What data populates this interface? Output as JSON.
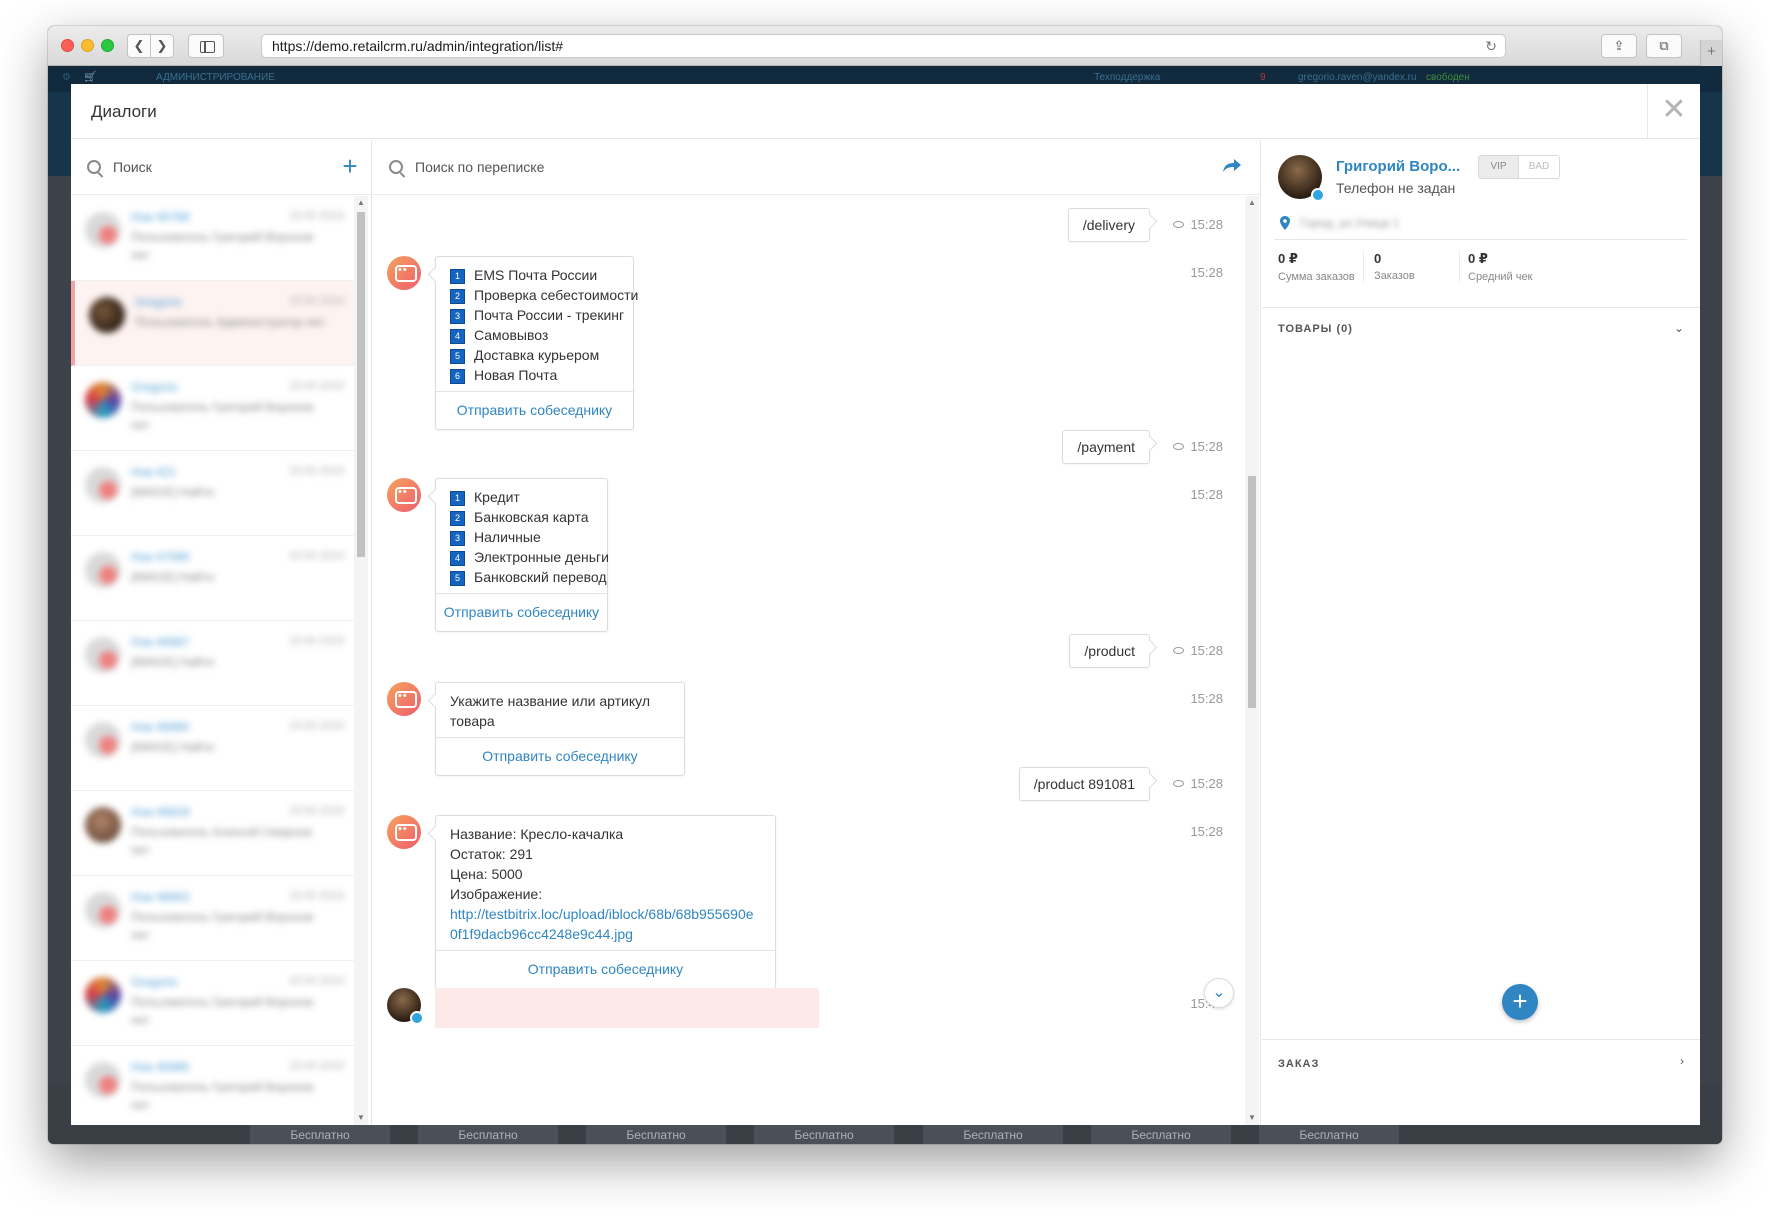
{
  "browser": {
    "url": "https://demo.retailcrm.ru/admin/integration/list#"
  },
  "crm_background": {
    "top_left_label": "АДМИНИСТРИРОВАНИЕ",
    "support": "Техподдержка",
    "notif_count": "9",
    "user_email": "gregorio.raven@yandex.ru",
    "user_status": "свободен",
    "free_label": "Бесплатно"
  },
  "modal": {
    "title": "Диалоги",
    "close_glyph": "✕"
  },
  "left_panel": {
    "search_placeholder": "Поиск",
    "add_glyph": "+",
    "dialogs": [
      {
        "name": "Нов 45789",
        "time": "15:00 2019",
        "preview": "Пользователь Григорий Воронов пит",
        "avatar": "red",
        "active": false
      },
      {
        "name": "Gregorio",
        "time": "15:00 2019",
        "preview": "Пользователь Администратор пит",
        "avatar": "photo",
        "active": true
      },
      {
        "name": "Gregorio",
        "time": "15:00 2019",
        "preview": "Пользователь Григорий Воронов пит",
        "avatar": "colorful",
        "active": false
      },
      {
        "name": "Нов 421",
        "time": "15:00 2019",
        "preview": "[IMAGE] Найти",
        "avatar": "red",
        "active": false
      },
      {
        "name": "Нов 47090",
        "time": "15:00 2019",
        "preview": "[IMAGE] Найти",
        "avatar": "red",
        "active": false
      },
      {
        "name": "Нов 46987",
        "time": "15:00 2019",
        "preview": "[IMAGE] Найти",
        "avatar": "red",
        "active": false
      },
      {
        "name": "Нов 46980",
        "time": "15:00 2019",
        "preview": "[IMAGE] Найти",
        "avatar": "red",
        "active": false
      },
      {
        "name": "Нов 46829",
        "time": "15:00 2019",
        "preview": "Пользователь Алексей Смирнов пит",
        "avatar": "bro",
        "active": false
      },
      {
        "name": "Нов 46663",
        "time": "15:00 2019",
        "preview": "Пользователь Григорий Воронов пит",
        "avatar": "red",
        "active": false
      },
      {
        "name": "Gregorio",
        "time": "15:00 2019",
        "preview": "Пользователь Григорий Воронов пит",
        "avatar": "colorful",
        "active": false
      },
      {
        "name": "Нов 45985",
        "time": "15:00 2019",
        "preview": "Пользователь Григорий Воронов пит",
        "avatar": "red",
        "active": false
      }
    ]
  },
  "chat": {
    "search_placeholder": "Поиск по переписке",
    "send_label": "Отправить собеседнику",
    "messages": {
      "out1": {
        "text": "/delivery",
        "time": "15:28"
      },
      "in1": {
        "time": "15:28",
        "options": [
          {
            "n": "1",
            "text": "EMS Почта России"
          },
          {
            "n": "2",
            "text": "Проверка себестоимости"
          },
          {
            "n": "3",
            "text": "Почта России - трекинг"
          },
          {
            "n": "4",
            "text": "Самовывоз"
          },
          {
            "n": "5",
            "text": "Доставка курьером"
          },
          {
            "n": "6",
            "text": "Новая Почта"
          }
        ]
      },
      "out2": {
        "text": "/payment",
        "time": "15:28"
      },
      "in2": {
        "time": "15:28",
        "options": [
          {
            "n": "1",
            "text": "Кредит"
          },
          {
            "n": "2",
            "text": "Банковская карта"
          },
          {
            "n": "3",
            "text": "Наличные"
          },
          {
            "n": "4",
            "text": "Электронные деньги"
          },
          {
            "n": "5",
            "text": "Банковский перевод"
          }
        ]
      },
      "out3": {
        "text": "/product",
        "time": "15:28"
      },
      "in3": {
        "time": "15:28",
        "text": "Укажите название или артикул товара"
      },
      "out4": {
        "text": "/product 891081",
        "time": "15:28"
      },
      "in4": {
        "time": "15:28",
        "name_line": "Название: Кресло-качалка",
        "stock_line": "Остаток: 291",
        "price_line": "Цена: 5000",
        "image_line": "Изображение:",
        "link": "http://testbitrix.loc/upload/iblock/68b/68b955690e0f1f9dacb96cc4248e9c44.jpg"
      },
      "last_time": "15:48"
    }
  },
  "customer": {
    "name": "Григорий Воро...",
    "phone": "Телефон не задан",
    "tag_vip": "VIP",
    "tag_bad": "BAD",
    "address": "Город, ул.Улица 1",
    "stats": [
      {
        "value": "0 ₽",
        "label": "Сумма заказов"
      },
      {
        "value": "0",
        "label": "Заказов"
      },
      {
        "value": "0 ₽",
        "label": "Средний чек"
      }
    ],
    "goods_section": "ТОВАРЫ (0)",
    "order_section": "ЗАКАЗ",
    "fab_glyph": "+"
  }
}
